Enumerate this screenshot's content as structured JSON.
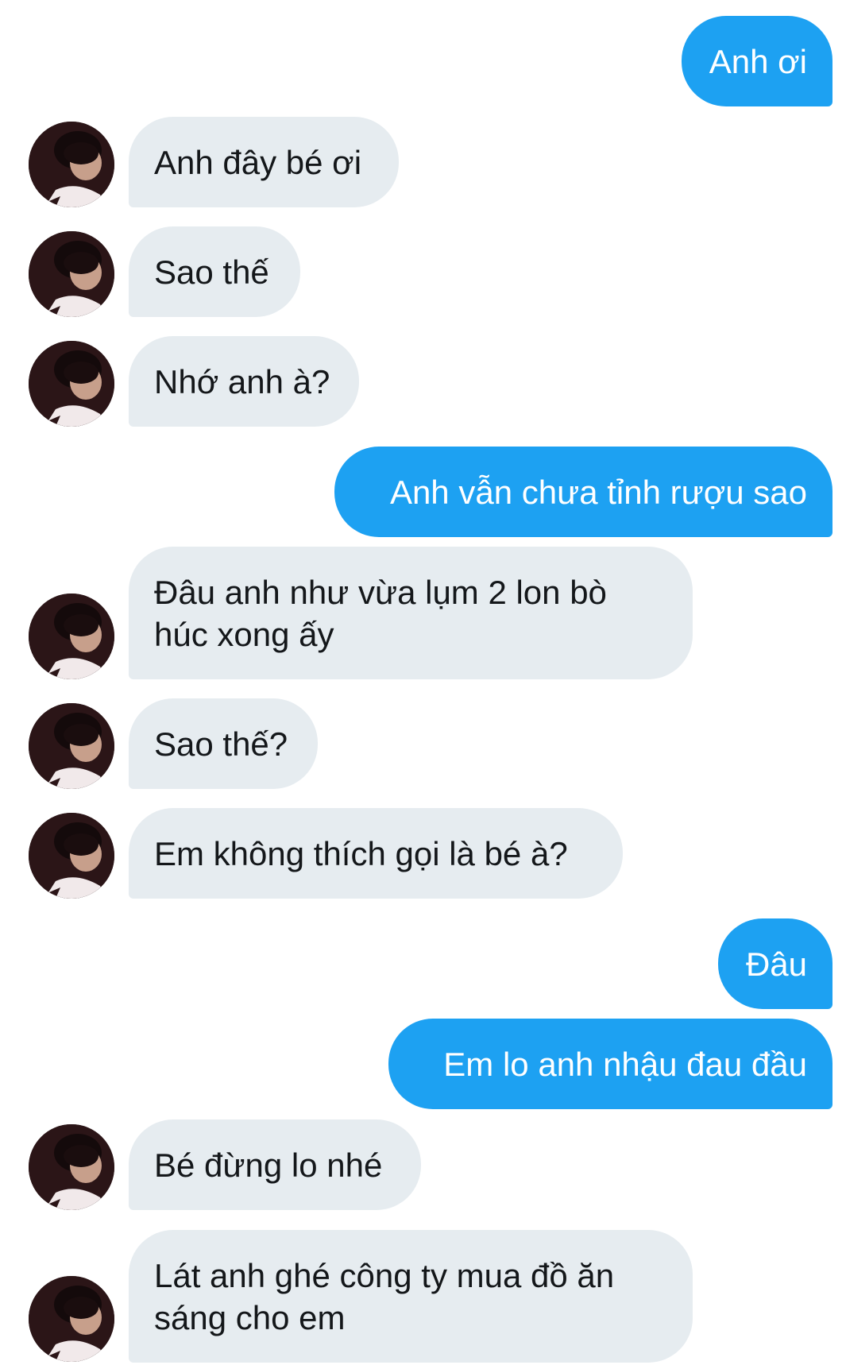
{
  "colors": {
    "outgoing_bubble": "#1da1f2",
    "incoming_bubble": "#e6ecf0",
    "incoming_text": "#14171a",
    "outgoing_text": "#ffffff"
  },
  "contact": {
    "avatar_icon": "profile-photo-avatar"
  },
  "messages": [
    {
      "direction": "out",
      "text": "Anh ơi"
    },
    {
      "direction": "in",
      "text": "Anh đây bé ơi"
    },
    {
      "direction": "in",
      "text": "Sao thế"
    },
    {
      "direction": "in",
      "text": "Nhớ anh à?"
    },
    {
      "direction": "out",
      "text": "Anh vẫn chưa tỉnh rượu sao"
    },
    {
      "direction": "in",
      "text": "Đâu anh như vừa lụm 2 lon bò\nhúc xong ấy"
    },
    {
      "direction": "in",
      "text": "Sao thế?"
    },
    {
      "direction": "in",
      "text": "Em không thích gọi là bé à?"
    },
    {
      "direction": "out",
      "text": "Đâu"
    },
    {
      "direction": "out",
      "text": "Em lo anh nhậu đau đầu"
    },
    {
      "direction": "in",
      "text": "Bé đừng lo nhé"
    },
    {
      "direction": "in",
      "text": "Lát anh ghé công ty mua đồ ăn\nsáng cho em"
    }
  ]
}
